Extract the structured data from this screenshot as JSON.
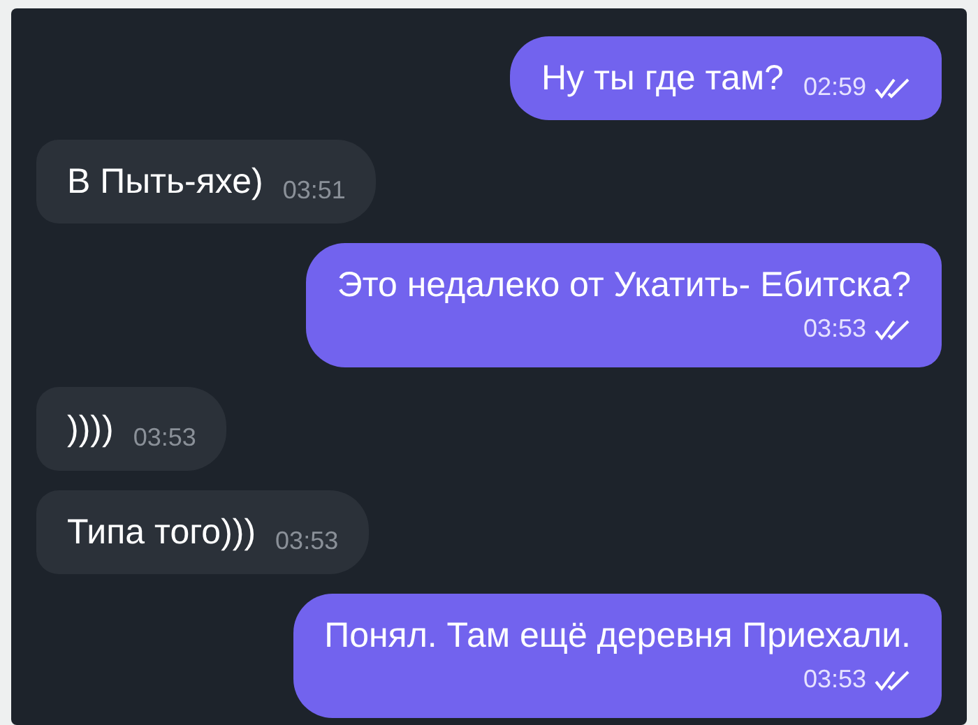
{
  "messages": [
    {
      "kind": "outgoing",
      "text": "Ну ты где там?",
      "time": "02:59",
      "read": true
    },
    {
      "kind": "incoming",
      "text": "В Пыть-яхе)",
      "time": "03:51"
    },
    {
      "kind": "outgoing",
      "text": "Это недалеко от Укатить- Ебитска?",
      "time": "03:53",
      "read": true
    },
    {
      "kind": "incoming",
      "text": "))))",
      "time": "03:53"
    },
    {
      "kind": "incoming",
      "text": "Типа того)))",
      "time": "03:53"
    },
    {
      "kind": "outgoing",
      "text": "Понял. Там ещё деревня Приехали.",
      "time": "03:53",
      "read": true
    }
  ]
}
